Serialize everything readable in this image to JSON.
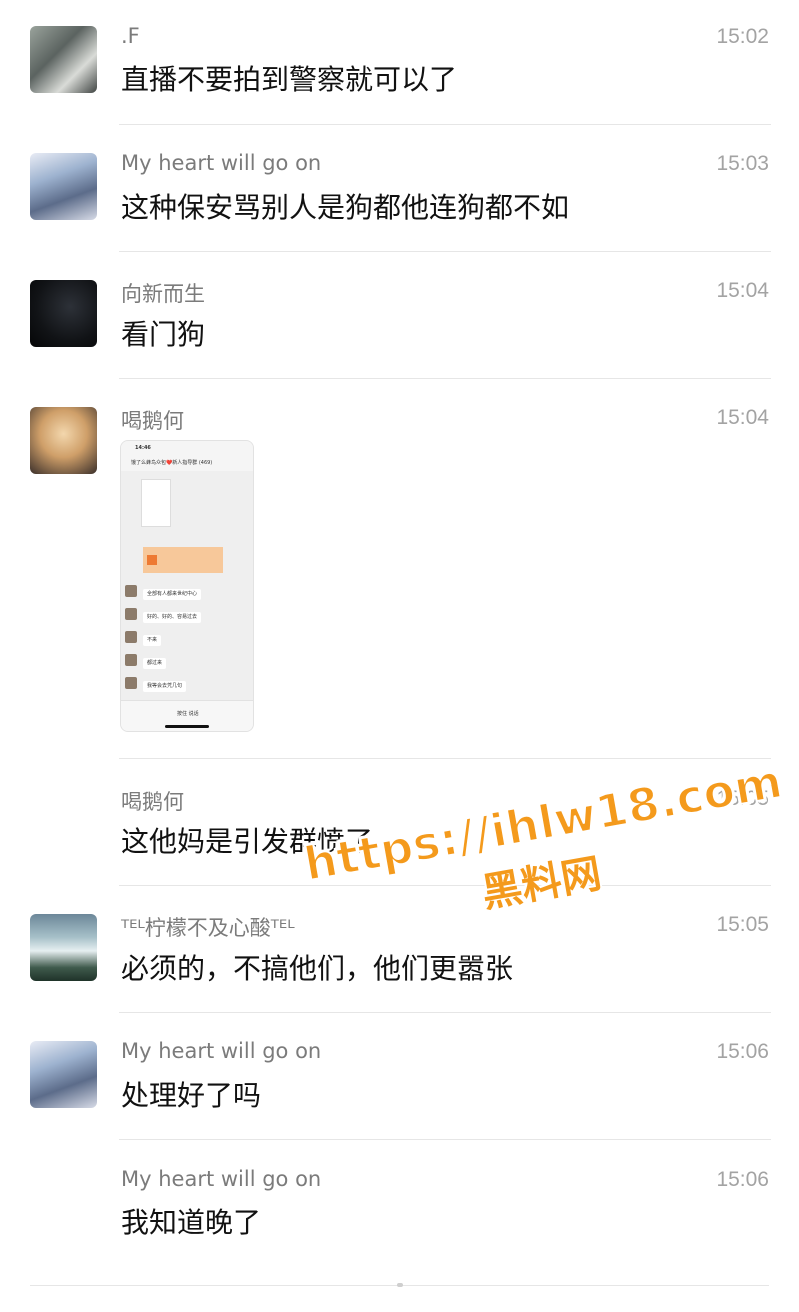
{
  "messages": [
    {
      "name": ".F",
      "time": "15:02",
      "text": "直播不要拍到警察就可以了"
    },
    {
      "name": "My heart will go on",
      "time": "15:03",
      "text": "这种保安骂别人是狗都他连狗都不如"
    },
    {
      "name": "向新而生",
      "time": "15:04",
      "text": "看门狗"
    },
    {
      "name": "喝鹅何",
      "time": "15:04",
      "text": ""
    },
    {
      "name": "喝鹅何",
      "time": "15:05",
      "text": "这他妈是引发群愤了"
    },
    {
      "name": "ᵀᴱᴸ柠檬不及心酸ᵀᴱᴸ",
      "time": "15:05",
      "text": "必须的，不搞他们，他们更嚣张"
    },
    {
      "name": "My heart will go on",
      "time": "15:06",
      "text": "处理好了吗"
    },
    {
      "name": "My heart will go on",
      "time": "15:06",
      "text": "我知道晚了"
    }
  ],
  "screenshot": {
    "status_time": "14:46",
    "title": "饿了么蜂鸟众包❤️新人指导群 (469)",
    "bubbles": [
      "全部有人都来世纪中心",
      "好的、好的、容易过去",
      "不来",
      "都过来",
      "我等会去凭几句"
    ],
    "input_label": "按住 说话"
  },
  "watermark": {
    "url": "https://ihlw18.com",
    "site": "黑料网"
  }
}
